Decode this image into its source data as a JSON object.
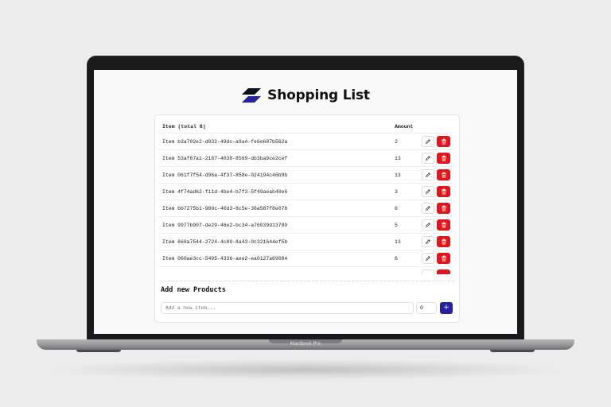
{
  "device": {
    "label": "MacBook Pro"
  },
  "app": {
    "title": "Shopping List",
    "logo_icon": "parallelogram-logo-icon",
    "accent_color": "#2521a3",
    "danger_color": "#e5141c"
  },
  "table": {
    "headers": {
      "item": "Item (total 8)",
      "amount": "Amount"
    },
    "rows": [
      {
        "name": "Item b3a702e2-d832-49dc-a9a4-fe6e687b562a",
        "amount": "2"
      },
      {
        "name": "Item 53af67a1-2167-4038-8569-db3ba9ce2cef",
        "amount": "13"
      },
      {
        "name": "Item 061f7f54-d96a-4f37-858e-024194c46b9b",
        "amount": "13"
      },
      {
        "name": "Item 4f74ad62-f11d-4be4-b7f3-5f49aeab40e6",
        "amount": "3"
      },
      {
        "name": "Item bb7275b1-980c-40d3-8c5e-36a587f8e076",
        "amount": "6"
      },
      {
        "name": "Item 9977b907-de29-46e2-bc34-a76039d13780",
        "amount": "5"
      },
      {
        "name": "Item 668a7544-2724-4c89-8a43-0c321644ef5b",
        "amount": "13"
      },
      {
        "name": "Item 060ae3cc-5495-4336-aee2-ea0127a69084",
        "amount": "6"
      }
    ],
    "edit_icon": "pencil-icon",
    "delete_icon": "trash-icon"
  },
  "add_form": {
    "title": "Add new Products",
    "name_placeholder": "Add a new item...",
    "quantity_value": "0",
    "add_label": "+"
  }
}
